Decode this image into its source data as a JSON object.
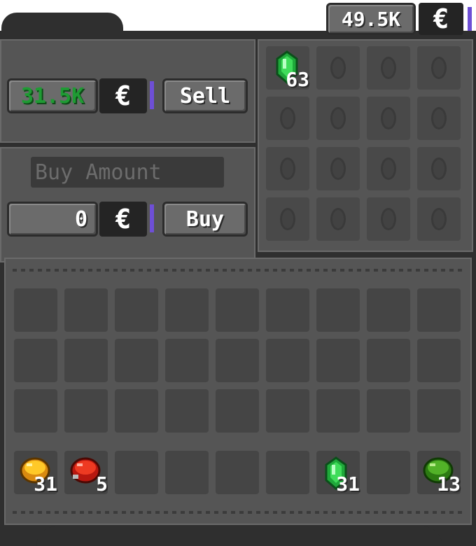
{
  "balance": {
    "value": "49.5K",
    "symbol": "€"
  },
  "sell": {
    "price": "31.5K",
    "symbol": "€",
    "button_label": "Sell"
  },
  "buy": {
    "amount_placeholder": "Buy Amount",
    "price": "0",
    "symbol": "€",
    "button_label": "Buy"
  },
  "shop_grid": {
    "rows": 4,
    "cols": 4,
    "items": [
      {
        "slot": 0,
        "name": "emerald",
        "count": "63"
      }
    ]
  },
  "inventory": {
    "rows": 4,
    "cols": 9,
    "hotbar": [
      {
        "slot": 0,
        "name": "gold-orb",
        "count": "31"
      },
      {
        "slot": 1,
        "name": "red-ball",
        "count": "5"
      },
      {
        "slot": 6,
        "name": "emerald",
        "count": "31"
      },
      {
        "slot": 8,
        "name": "green-orb",
        "count": "13"
      }
    ]
  },
  "colors": {
    "price_green": "#1f9b34",
    "accent_purple": "#6e4fd6",
    "panel": "#555555",
    "frame": "#2f2f2f"
  }
}
